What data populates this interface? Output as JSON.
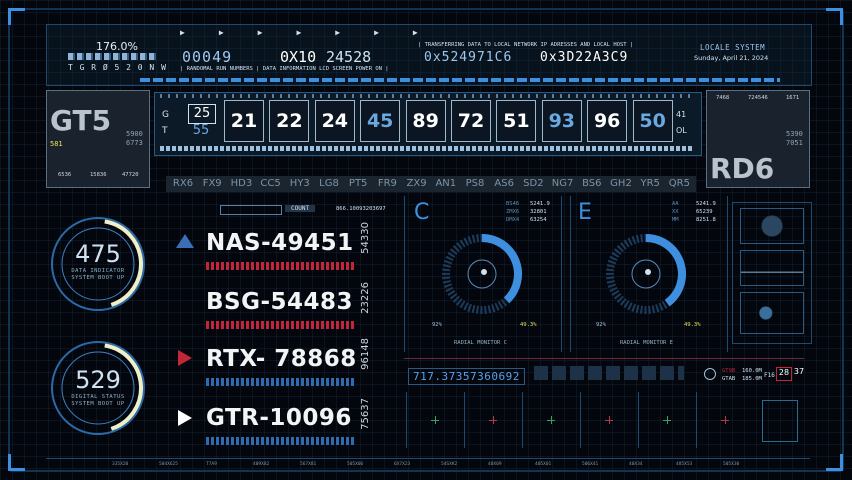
{
  "top": {
    "percent": "176.0%",
    "letters": "T G R Ø 5 2 0 N W",
    "counter_a": "00049",
    "counter_b": "0X10",
    "counter_c": "24528",
    "caption_left": "| RANDOMAL RUN NUMBERS | DATA INFORMATION LCD SCREEN POWER ON |",
    "caption_right": "| TRANSFERRING DATA TO LOCAL NETWORK IP ADRESSES AND LOCAL HOST |",
    "hex_a": "0x524971C6",
    "hex_b": "0x3D22A3C9",
    "locale_title": "LOCALE SYSTEM",
    "date": "Sunday, April 21, 2024"
  },
  "left_box": {
    "code": "GT5",
    "n1": "5900",
    "n2": "6773",
    "n3": "581",
    "f1": "6536",
    "f2": "15836",
    "f3": "47720"
  },
  "right_box": {
    "code": "RD6",
    "t1": "7468",
    "t2": "724546",
    "t3": "1671",
    "n1": "5390",
    "n2": "7051"
  },
  "strip": {
    "left_g": "G",
    "left_t": "T",
    "pair_top": "25",
    "pair_bottom": "55",
    "right_top": "41",
    "right_bottom": "OL",
    "tiles": [
      "21",
      "22",
      "24",
      "45",
      "89",
      "72",
      "51",
      "93",
      "96",
      "50"
    ]
  },
  "codes": [
    "RX6",
    "FX9",
    "HD3",
    "CC5",
    "HY3",
    "LG8",
    "PT5",
    "FR9",
    "ZX9",
    "AN1",
    "PS8",
    "AS6",
    "SD2",
    "NG7",
    "BS6",
    "GH2",
    "YR5",
    "QR5"
  ],
  "mid_header": {
    "count_label": "COUNT",
    "count_value": "866.10093203697"
  },
  "dials": [
    {
      "value": "475",
      "line1": "DATA INDICATOR",
      "line2": "SYSTEM BOOT UP"
    },
    {
      "value": "529",
      "line1": "DIGITAL STATUS",
      "line2": "SYSTEM BOOT UP"
    }
  ],
  "entries": [
    {
      "code": "NAS-49451",
      "side": "54330",
      "marker": "▲"
    },
    {
      "code": "BSG-54483",
      "side": "23226",
      "marker": ""
    },
    {
      "code": "RTX- 78868",
      "side": "96148",
      "marker": "▶"
    },
    {
      "code": "GTR-10096",
      "side": "75637",
      "marker": "▶"
    }
  ],
  "monitor_c": {
    "letter": "C",
    "rows": [
      [
        "BS46",
        "5241.9"
      ],
      [
        "ZMX6",
        "32801"
      ],
      [
        "DMX4",
        "63254"
      ]
    ],
    "left_pct": "92%",
    "right_pct": "49.3%",
    "caption": "RADIAL MONITOR C",
    "level": 0.38
  },
  "monitor_e": {
    "letter": "E",
    "rows": [
      [
        "AA",
        "5241.9"
      ],
      [
        "XX",
        "65239"
      ],
      [
        "MM",
        "8251.8"
      ]
    ],
    "left_pct": "92%",
    "right_pct": "49.3%",
    "caption": "RADIAL MONITOR E",
    "level": 0.4
  },
  "lower": {
    "long_number": "717.37357360692",
    "r1_label": "GT9B",
    "r1_value": "160.0M",
    "r2_label": "GTAB",
    "r2_value": "185.0M",
    "f_value": "F16",
    "d1": "28",
    "d2": "37"
  },
  "footer_ticks": [
    "335X20",
    "504X625",
    "T7A9",
    "409X82",
    "567X81",
    "505X06",
    "6X7X23",
    "54SXK2",
    "40X09",
    "405X01",
    "506X41",
    "40X34",
    "485X53",
    "505X30"
  ],
  "colors": {
    "accent": "#3f8fe0",
    "frame": "#1f4e78",
    "alert": "#c3263a",
    "dial_arc": "#f0f0c8"
  }
}
